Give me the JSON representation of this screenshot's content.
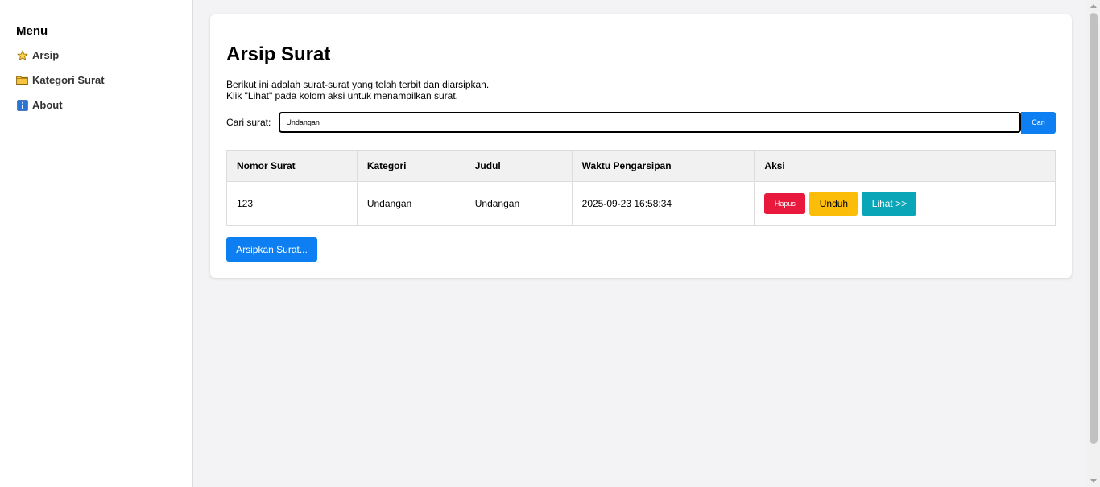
{
  "sidebar": {
    "title": "Menu",
    "items": [
      {
        "label": "Arsip",
        "icon": "star-icon"
      },
      {
        "label": "Kategori Surat",
        "icon": "folder-icon"
      },
      {
        "label": "About",
        "icon": "info-icon"
      }
    ]
  },
  "page": {
    "title": "Arsip Surat",
    "desc_line1": "Berikut ini adalah surat-surat yang telah terbit dan diarsipkan.",
    "desc_line2": "Klik \"Lihat\" pada kolom aksi untuk menampilkan surat."
  },
  "search": {
    "label": "Cari surat:",
    "value": "Undangan",
    "button": "Cari"
  },
  "table": {
    "headers": [
      "Nomor Surat",
      "Kategori",
      "Judul",
      "Waktu Pengarsipan",
      "Aksi"
    ],
    "rows": [
      {
        "nomor": "123",
        "kategori": "Undangan",
        "judul": "Undangan",
        "waktu": "2025-09-23 16:58:34",
        "actions": {
          "hapus": "Hapus",
          "unduh": "Unduh",
          "lihat": "Lihat >>"
        }
      }
    ]
  },
  "archive_button": "Arsipkan Surat...",
  "colors": {
    "primary": "#0d7ff2",
    "danger": "#e8193c",
    "warning": "#fbbd08",
    "info": "#0ba5b8"
  }
}
